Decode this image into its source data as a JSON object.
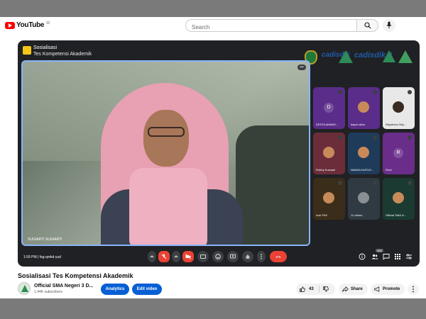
{
  "header": {
    "brand": "YouTube",
    "brand_sup": "ID",
    "search_placeholder": "Search"
  },
  "meet": {
    "title": "Sosialisasi",
    "subtitle": "Tes Kompetensi Akademik",
    "logo_text_1": "cadisdik",
    "logo_text_2": "cadisdik II",
    "main_speaker": "SUGIARTI SUGIARTI",
    "time": "1:59 PM",
    "meeting_code": "fsg-qmkd-yud",
    "participant_count": "100",
    "tiles": [
      {
        "name": "DESTA AMAND...",
        "initial": "D",
        "color": "#5b2d8a"
      },
      {
        "name": "dapur akhu",
        "initial": "",
        "color": "#5b2d8a"
      },
      {
        "name": "Wiyartono Wiy...",
        "initial": "",
        "color": "#e8e8e8"
      },
      {
        "name": "Robby Kusnadi",
        "initial": "",
        "color": "#6b2d3a"
      },
      {
        "name": "NANDA NUFUS...",
        "initial": "",
        "color": "#1f3b5a"
      },
      {
        "name": "Rizki",
        "initial": "R",
        "color": "#6a2d8a"
      },
      {
        "name": "Ardi PKK",
        "initial": "",
        "color": "#3a2e1a"
      },
      {
        "name": "11 others",
        "initial": "",
        "color": "#2f3a42"
      },
      {
        "name": "Official SMA N...",
        "initial": "",
        "color": "#1a3a32"
      }
    ]
  },
  "video": {
    "title": "Sosialisasi Tes Kompetensi Akademik",
    "channel": "Official SMA Negeri 3 D...",
    "subscribers": "1.44K subscribers",
    "analytics_label": "Analytics",
    "edit_label": "Edit video",
    "likes": "43",
    "share_label": "Share",
    "promote_label": "Promote"
  }
}
